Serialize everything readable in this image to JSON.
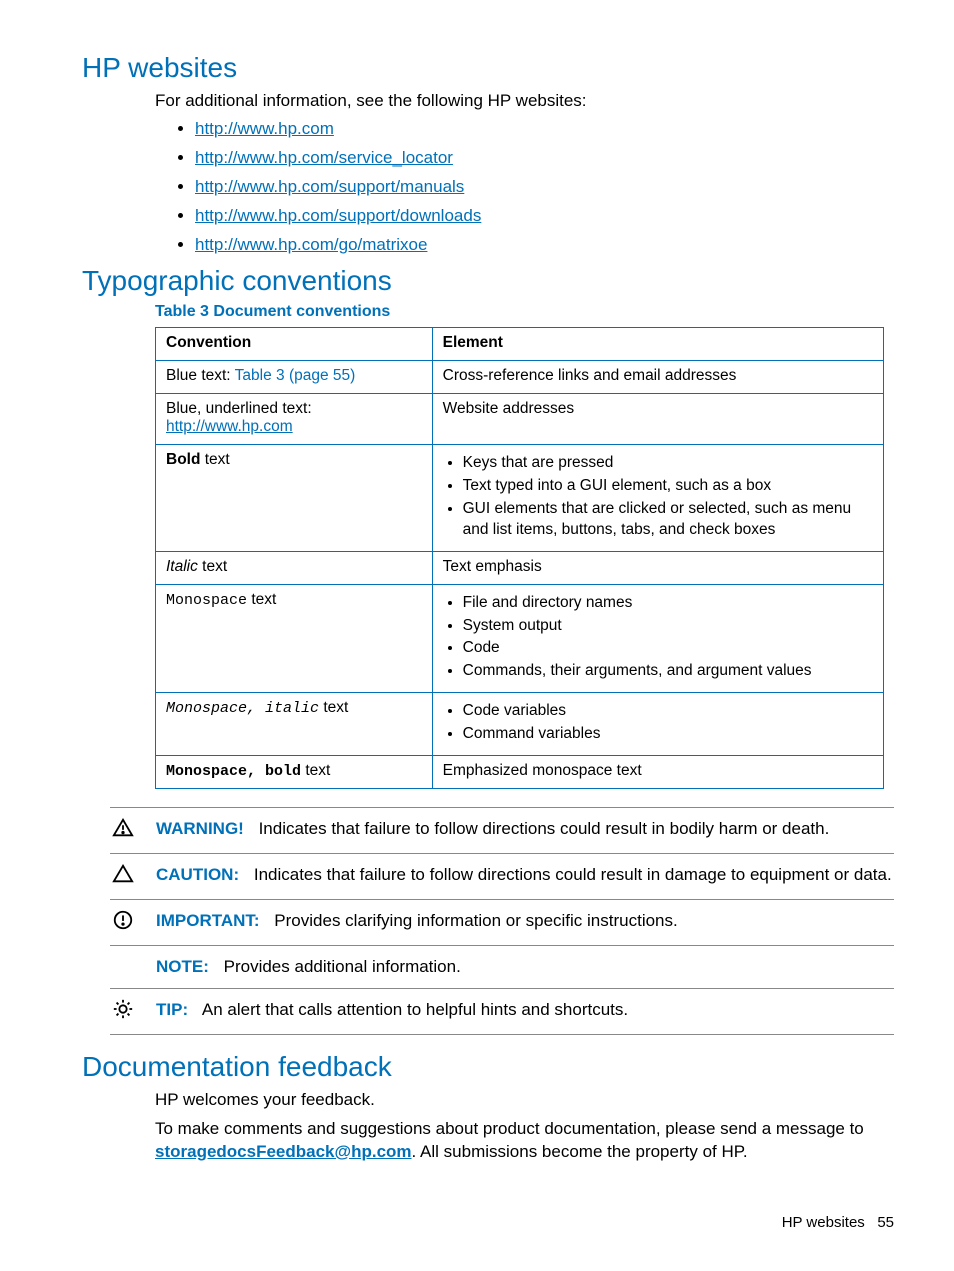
{
  "sections": {
    "hp_websites": {
      "heading": "HP websites",
      "intro": "For additional information, see the following HP websites:",
      "links": [
        "http://www.hp.com",
        "http://www.hp.com/service_locator",
        "http://www.hp.com/support/manuals",
        "http://www.hp.com/support/downloads",
        "http://www.hp.com/go/matrixoe"
      ]
    },
    "typographic": {
      "heading": "Typographic conventions",
      "table_caption": "Table 3 Document conventions",
      "headers": {
        "c1": "Convention",
        "c2": "Element"
      },
      "rows": {
        "r1": {
          "conv_prefix": "Blue text: ",
          "conv_link": "Table 3 (page 55)",
          "elem": "Cross-reference links and email addresses"
        },
        "r2": {
          "conv_prefix": "Blue, underlined text: ",
          "conv_link": "http://www.hp.com",
          "elem": "Website addresses"
        },
        "r3": {
          "conv_bold": "Bold",
          "conv_suffix": " text",
          "items": [
            "Keys that are pressed",
            "Text typed into a GUI element, such as a box",
            "GUI elements that are clicked or selected, such as menu and list items, buttons, tabs, and check boxes"
          ]
        },
        "r4": {
          "conv_ital": "Italic",
          "conv_suffix": " text",
          "elem": "Text emphasis"
        },
        "r5": {
          "conv_mono": "Monospace",
          "conv_suffix": " text",
          "items": [
            "File and directory names",
            "System output",
            "Code",
            "Commands, their arguments, and argument values"
          ]
        },
        "r6": {
          "conv_mono": "Monospace, italic",
          "conv_suffix": " text",
          "items": [
            "Code variables",
            "Command variables"
          ]
        },
        "r7": {
          "conv_mono": "Monospace, bold",
          "conv_suffix": " text",
          "elem": "Emphasized monospace text"
        }
      }
    },
    "admonitions": [
      {
        "icon": "warning",
        "label": "WARNING!",
        "text": "Indicates that failure to follow directions could result in bodily harm or death."
      },
      {
        "icon": "caution",
        "label": "CAUTION:",
        "text": "Indicates that failure to follow directions could result in damage to equipment or data."
      },
      {
        "icon": "important",
        "label": "IMPORTANT:",
        "text": "Provides clarifying information or specific instructions."
      },
      {
        "icon": "",
        "label": "NOTE:",
        "text": "Provides additional information."
      },
      {
        "icon": "tip",
        "label": "TIP:",
        "text": "An alert that calls attention to helpful hints and shortcuts."
      }
    ],
    "feedback": {
      "heading": "Documentation feedback",
      "p1": "HP welcomes your feedback.",
      "p2_pre": "To make comments and suggestions about product documentation, please send a message to ",
      "email": "storagedocsFeedback@hp.com",
      "p2_post": ". All submissions become the property of HP."
    }
  },
  "footer": {
    "section": "HP websites",
    "page": "55"
  }
}
